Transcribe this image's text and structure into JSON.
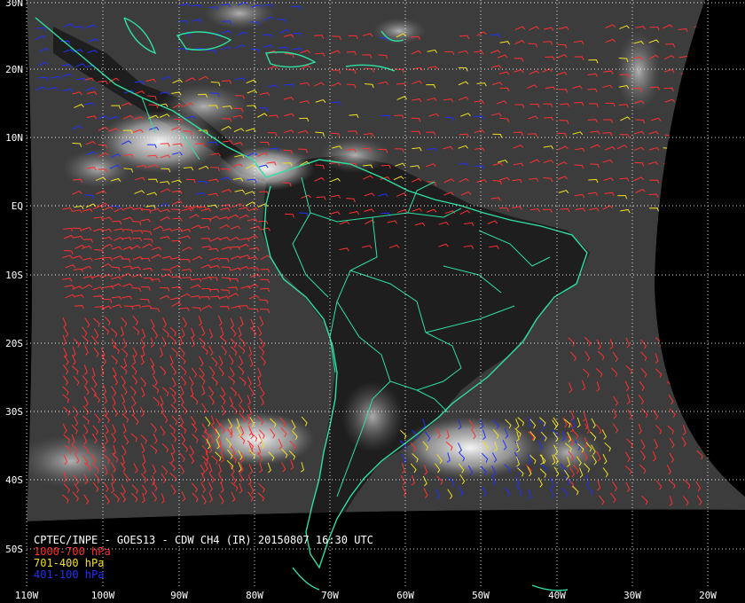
{
  "map": {
    "caption": "CPTEC/INPE - GOES13 - CDW CH4 (IR) 20150807 16:30 UTC",
    "legend": [
      {
        "label": "1000-700 hPa",
        "color": "#ff3030"
      },
      {
        "label": "701-400 hPa",
        "color": "#f0e020"
      },
      {
        "label": "401-100 hPa",
        "color": "#2030ff"
      }
    ],
    "lat_labels": [
      "30N",
      "20N",
      "10N",
      "EQ",
      "10S",
      "20S",
      "30S",
      "40S",
      "50S"
    ],
    "lon_labels": [
      "110W",
      "100W",
      "90W",
      "80W",
      "70W",
      "60W",
      "50W",
      "40W",
      "30W",
      "20W"
    ],
    "coast_color": "#2fe0a0"
  }
}
